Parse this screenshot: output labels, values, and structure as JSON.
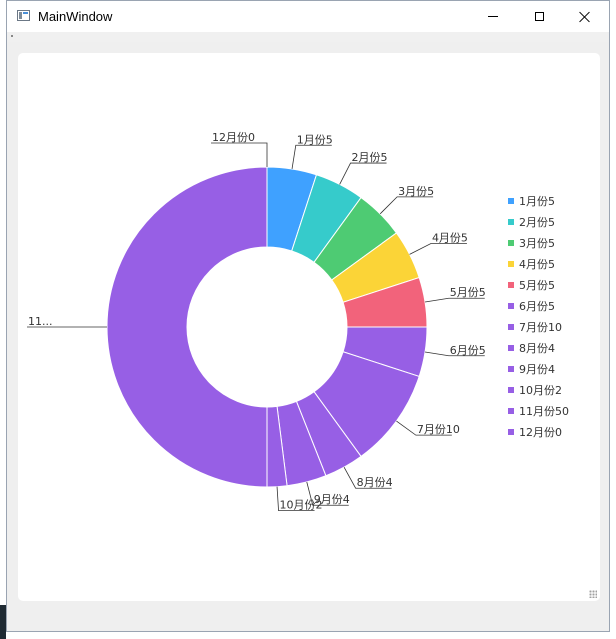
{
  "window": {
    "title": "MainWindow",
    "buttons": {
      "minimize": "minimize-icon",
      "maximize": "maximize-icon",
      "close": "close-icon"
    }
  },
  "chart_data": {
    "type": "pie",
    "donut": true,
    "legend_position": "right",
    "categories": [
      "1月份",
      "2月份",
      "3月份",
      "4月份",
      "5月份",
      "6月份",
      "7月份",
      "8月份",
      "9月份",
      "10月份",
      "11月份",
      "12月份"
    ],
    "values": [
      5,
      5,
      5,
      5,
      5,
      5,
      10,
      4,
      4,
      2,
      50,
      0
    ],
    "legend_labels": [
      "1月份5",
      "2月份5",
      "3月份5",
      "4月份5",
      "5月份5",
      "6月份5",
      "7月份10",
      "8月份4",
      "9月份4",
      "10月份2",
      "11月份50",
      "12月份0"
    ],
    "slice_labels": [
      "1月份5",
      "2月份5",
      "3月份5",
      "4月份5",
      "5月份5",
      "6月份5",
      "7月份10",
      "8月份4",
      "9月份4",
      "10月份2",
      "11...",
      "12月份0"
    ],
    "colors": [
      "#3fa1ff",
      "#36cbcb",
      "#4ecb73",
      "#fbd437",
      "#f2637b",
      "#975fe5",
      "#975fe5",
      "#975fe5",
      "#975fe5",
      "#975fe5",
      "#975fe5",
      "#975fe5"
    ]
  }
}
